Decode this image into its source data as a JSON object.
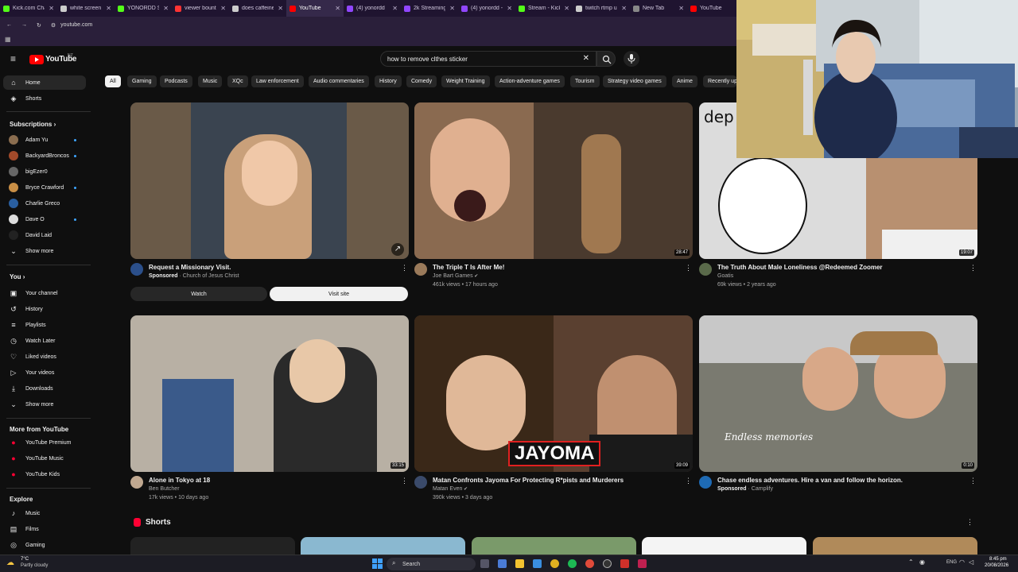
{
  "browser": {
    "tabs": [
      {
        "title": "Kick.com Cha",
        "color": "#53fc18"
      },
      {
        "title": "white screen",
        "color": "#cccccc"
      },
      {
        "title": "YONORDD St",
        "color": "#53fc18"
      },
      {
        "title": "viewer bounti",
        "color": "#ff3333"
      },
      {
        "title": "does caffeine",
        "color": "#cccccc"
      },
      {
        "title": "YouTube",
        "color": "#ff0000"
      },
      {
        "title": "(4) yonordd",
        "color": "#9146ff"
      },
      {
        "title": "2k Streaming",
        "color": "#9146ff"
      },
      {
        "title": "(4) yonordd -",
        "color": "#9146ff"
      },
      {
        "title": "Stream - Kick",
        "color": "#53fc18"
      },
      {
        "title": "twitch rtmp u",
        "color": "#cccccc"
      },
      {
        "title": "New Tab",
        "color": "#888888"
      },
      {
        "title": "YouTube",
        "color": "#ff0000"
      }
    ],
    "url": "youtube.com"
  },
  "header": {
    "logo_text": "YouTube",
    "country": "NZ",
    "search_value": "how to remove clthes sticker"
  },
  "sidebar": {
    "main": [
      {
        "label": "Home",
        "icon": "home-icon",
        "glyph": "⌂",
        "active": true
      },
      {
        "label": "Shorts",
        "icon": "shorts-icon",
        "glyph": "◈"
      }
    ],
    "subscriptions_title": "Subscriptions",
    "subscriptions": [
      {
        "label": "Adam Yu",
        "color": "#8a6d4f",
        "dot": true
      },
      {
        "label": "BackyardBroncos",
        "color": "#a24a2a",
        "dot": true
      },
      {
        "label": "bigEzer0",
        "color": "#666666",
        "dot": false
      },
      {
        "label": "Bryce Crawford",
        "color": "#c98f46",
        "dot": true
      },
      {
        "label": "Charlie Greco",
        "color": "#2a5fa0",
        "dot": false
      },
      {
        "label": "Dave O",
        "color": "#dddddd",
        "dot": true
      },
      {
        "label": "David Laid",
        "color": "#222222",
        "dot": false
      }
    ],
    "show_more_1": "Show more",
    "you_title": "You",
    "you_items": [
      {
        "label": "Your channel",
        "icon": "channel-icon",
        "glyph": "▣"
      },
      {
        "label": "History",
        "icon": "history-icon",
        "glyph": "↺"
      },
      {
        "label": "Playlists",
        "icon": "playlists-icon",
        "glyph": "≡"
      },
      {
        "label": "Watch Later",
        "icon": "watch-later-icon",
        "glyph": "◷"
      },
      {
        "label": "Liked videos",
        "icon": "like-icon",
        "glyph": "♡"
      },
      {
        "label": "Your videos",
        "icon": "your-videos-icon",
        "glyph": "▷"
      },
      {
        "label": "Downloads",
        "icon": "download-icon",
        "glyph": "⤓"
      }
    ],
    "show_more_2": "Show more",
    "more_title": "More from YouTube",
    "more_items": [
      {
        "label": "YouTube Premium",
        "color": "#ff0033"
      },
      {
        "label": "YouTube Music",
        "color": "#ff0033"
      },
      {
        "label": "YouTube Kids",
        "color": "#ff0033"
      }
    ],
    "explore_title": "Explore",
    "explore_items": [
      {
        "label": "Music",
        "icon": "music-icon",
        "glyph": "♪"
      },
      {
        "label": "Films",
        "icon": "films-icon",
        "glyph": "▤"
      },
      {
        "label": "Gaming",
        "icon": "gaming-icon",
        "glyph": "◎"
      }
    ]
  },
  "chips": [
    "All",
    "Gaming",
    "Podcasts",
    "Music",
    "XQc",
    "Law enforcement",
    "Audio commentaries",
    "History",
    "Comedy",
    "Weight Training",
    "Action-adventure games",
    "Tourism",
    "Strategy video games",
    "Anime",
    "Recently up"
  ],
  "videos": [
    {
      "title": "Request a Missionary Visit.",
      "channel": "Church of Jesus Christ",
      "sponsored": "Sponsored",
      "stats": "",
      "duration": "",
      "thumb": "#6a5a48",
      "av": "#2b4f8a",
      "ad": true,
      "watch": "Watch",
      "visit": "Visit site"
    },
    {
      "title": "The Triple T Is After Me!",
      "channel": "Joe Bart Games",
      "stats": "461k views • 17 hours ago",
      "duration": "28:47",
      "thumb": "#4a3a2e",
      "av": "#9a7a5a",
      "verified": true
    },
    {
      "title": "The Truth About Male Loneliness @Redeemed Zoomer",
      "channel": "Goatis",
      "stats": "69k views • 2 years ago",
      "duration": "19:07",
      "thumb": "#dcdcdc",
      "av": "#5a6a4a"
    },
    {
      "title": "Alone in Tokyo at 18",
      "channel": "Ben Butcher",
      "stats": "17k views • 10 days ago",
      "duration": "33:15",
      "thumb": "#b8b0a4",
      "av": "#c0a890"
    },
    {
      "title": "Matan Confronts Jayoma For Protecting R*pists and Murderers",
      "channel": "Matan Even",
      "stats": "390k views • 3 days ago",
      "duration": "39:09",
      "thumb": "#5a4030",
      "av": "#3a4a6a",
      "verified": true,
      "overlay": "JAYOMA"
    },
    {
      "title": "Chase endless adventures. Hire a van and follow the horizon.",
      "channel": "Camplify",
      "sponsored": "Sponsored",
      "stats": "",
      "duration": "0:10",
      "thumb": "#7a7a70",
      "av": "#1e6ab4",
      "overlay2": "Endless memories"
    }
  ],
  "shorts_title": "Shorts",
  "thumb_text_1": "dep",
  "taskbar": {
    "weather_temp": "7°C",
    "weather_desc": "Partly cloudy",
    "search": "Search",
    "lang": "ENG",
    "time": "8:45 pm",
    "date": "20/08/2026"
  }
}
